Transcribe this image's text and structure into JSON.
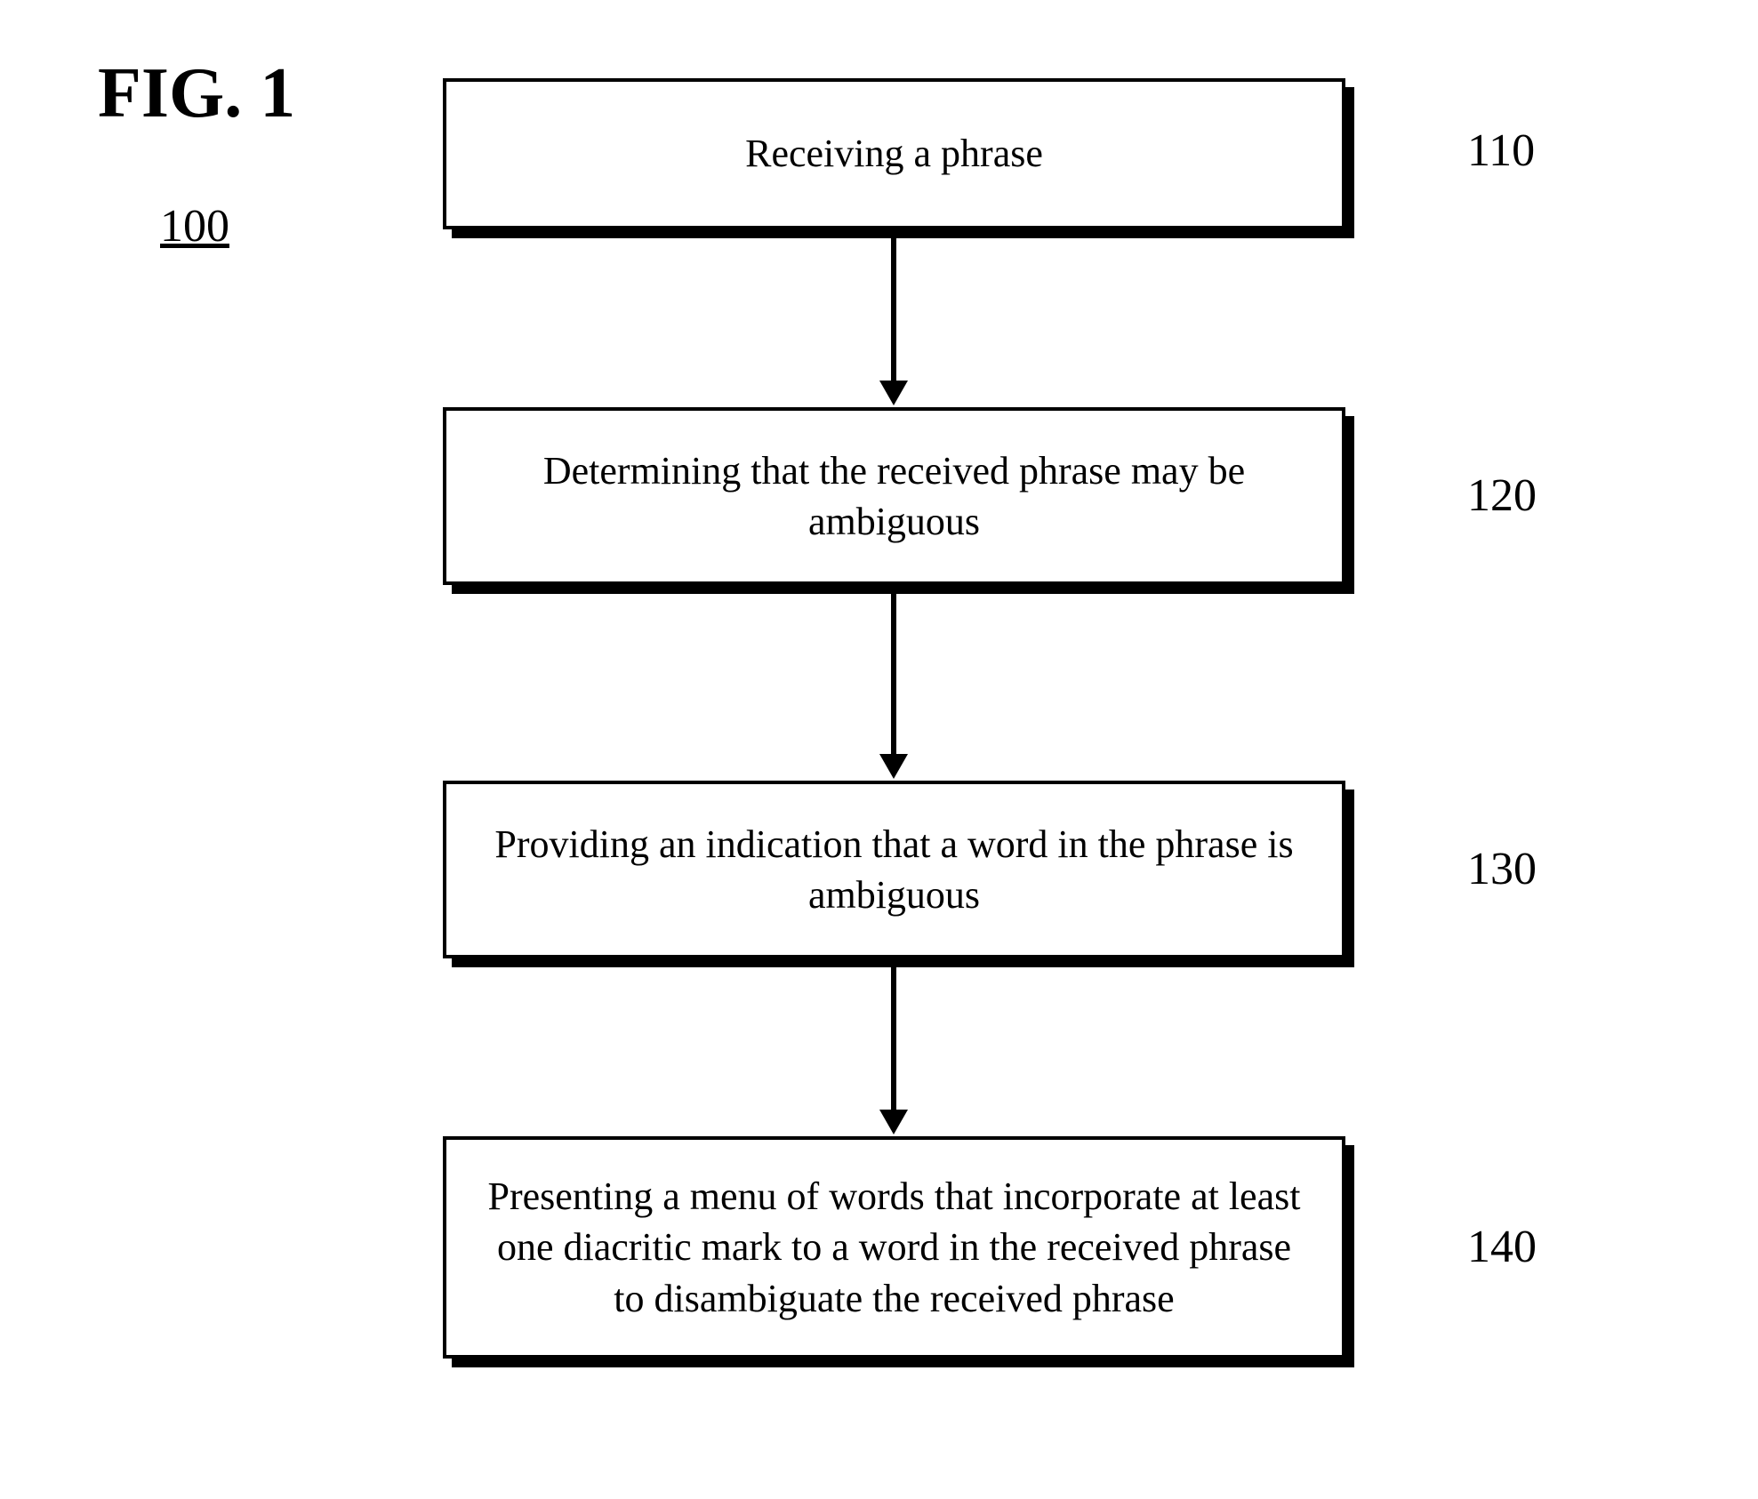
{
  "figure": {
    "title": "FIG. 1",
    "reference_number": "100"
  },
  "steps": [
    {
      "ref": "110",
      "text": "Receiving a phrase"
    },
    {
      "ref": "120",
      "text": "Determining that the received phrase may be ambiguous"
    },
    {
      "ref": "130",
      "text": "Providing an indication that a word in the phrase is ambiguous"
    },
    {
      "ref": "140",
      "text": "Presenting a menu of words that incorporate at least one diacritic mark to a word in the received phrase to disambiguate the received phrase"
    }
  ],
  "chart_data": {
    "type": "flowchart",
    "title": "FIG. 1",
    "reference": "100",
    "nodes": [
      {
        "id": "110",
        "label": "Receiving a phrase"
      },
      {
        "id": "120",
        "label": "Determining that the received phrase may be ambiguous"
      },
      {
        "id": "130",
        "label": "Providing an indication that a word in the phrase is ambiguous"
      },
      {
        "id": "140",
        "label": "Presenting a menu of words that incorporate at least one diacritic mark to a word in the received phrase to disambiguate the received phrase"
      }
    ],
    "edges": [
      {
        "from": "110",
        "to": "120"
      },
      {
        "from": "120",
        "to": "130"
      },
      {
        "from": "130",
        "to": "140"
      }
    ]
  }
}
